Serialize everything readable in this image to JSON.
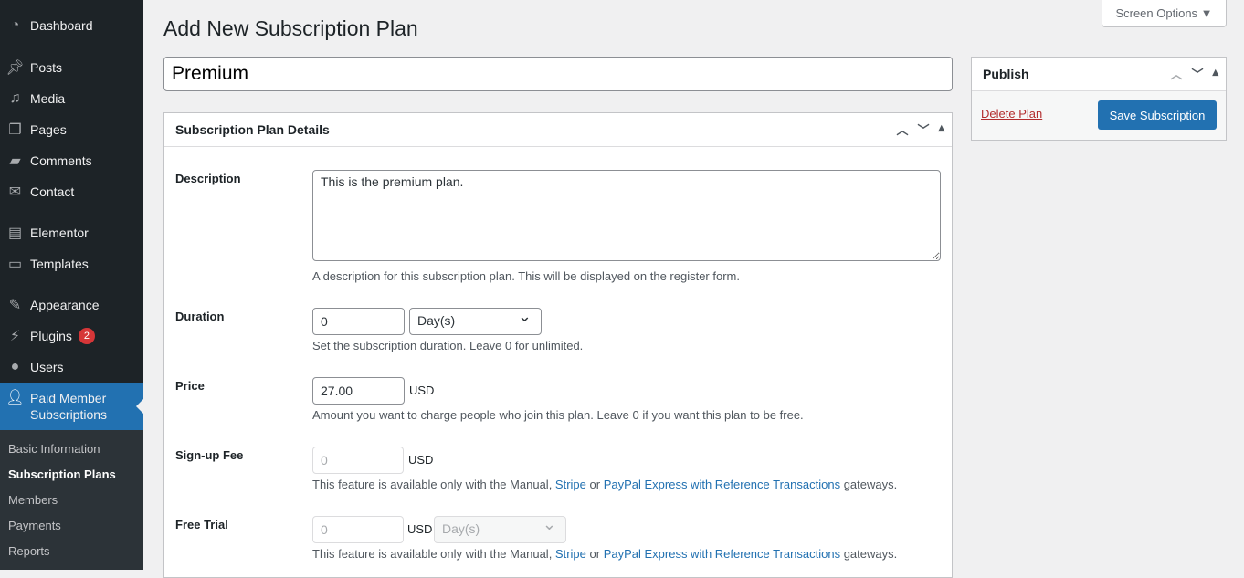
{
  "sidebar": {
    "items": [
      {
        "label": "Dashboard",
        "icon": "dashboard-icon"
      },
      {
        "label": "Posts",
        "icon": "pin-icon"
      },
      {
        "label": "Media",
        "icon": "media-icon"
      },
      {
        "label": "Pages",
        "icon": "pages-icon"
      },
      {
        "label": "Comments",
        "icon": "comment-icon"
      },
      {
        "label": "Contact",
        "icon": "mail-icon"
      },
      {
        "label": "Elementor",
        "icon": "elementor-icon"
      },
      {
        "label": "Templates",
        "icon": "folder-icon"
      },
      {
        "label": "Appearance",
        "icon": "brush-icon"
      },
      {
        "label": "Plugins",
        "icon": "plugin-icon",
        "badge": "2"
      },
      {
        "label": "Users",
        "icon": "user-icon"
      },
      {
        "label": "Paid Member Subscriptions",
        "icon": "member-dollar-icon"
      }
    ],
    "sub": [
      "Basic Information",
      "Subscription Plans",
      "Members",
      "Payments",
      "Reports"
    ]
  },
  "page": {
    "title": "Add New Subscription Plan",
    "screen_options": "Screen Options ▼",
    "plan_name": "Premium"
  },
  "details": {
    "heading": "Subscription Plan Details",
    "description": {
      "label": "Description",
      "value": "This is the premium plan.",
      "help": "A description for this subscription plan. This will be displayed on the register form."
    },
    "duration": {
      "label": "Duration",
      "value": "0",
      "unit": "Day(s)",
      "help": "Set the subscription duration. Leave 0 for unlimited."
    },
    "price": {
      "label": "Price",
      "value": "27.00",
      "currency": "USD",
      "help": "Amount you want to charge people who join this plan. Leave 0 if you want this plan to be free."
    },
    "signup": {
      "label": "Sign-up Fee",
      "value": "0",
      "currency": "USD"
    },
    "trial": {
      "label": "Free Trial",
      "value": "0",
      "currency": "USD",
      "unit": "Day(s)"
    },
    "gateway_help": {
      "pre": "This feature is available only with the Manual, ",
      "stripe": "Stripe",
      "mid": " or ",
      "paypal": "PayPal Express with Reference Transactions",
      "post": " gateways."
    }
  },
  "publish": {
    "heading": "Publish",
    "delete": "Delete Plan",
    "save": "Save Subscription"
  }
}
